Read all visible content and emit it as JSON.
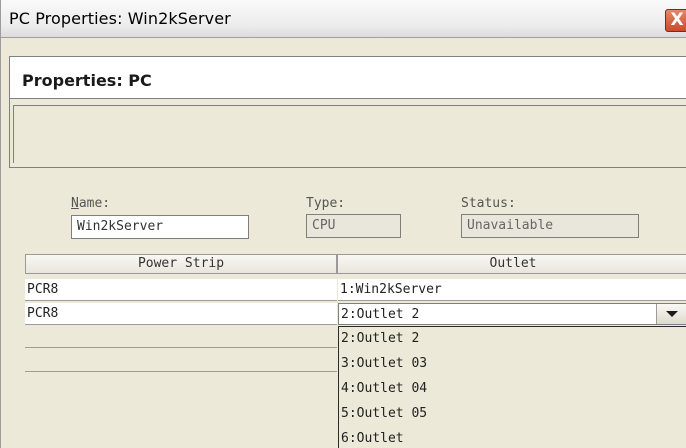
{
  "window": {
    "title": "PC Properties: Win2kServer",
    "close_glyph": "X"
  },
  "header": {
    "title": "Properties: PC"
  },
  "fields": {
    "name_label": "Name:",
    "name_value": "Win2kServer",
    "type_label": "Type:",
    "type_value": "CPU",
    "status_label": "Status:",
    "status_value": "Unavailable"
  },
  "grid": {
    "columns": [
      "Power Strip",
      "Outlet"
    ],
    "rows": [
      {
        "power_strip": "PCR8",
        "outlet": "1:Win2kServer"
      },
      {
        "power_strip": "PCR8",
        "outlet": "2:Outlet 2"
      }
    ]
  },
  "dropdown": {
    "selected": "2:Outlet 2",
    "options": [
      "2:Outlet 2",
      "3:Outlet 03",
      "4:Outlet 04",
      "5:Outlet 05",
      "6:Outlet"
    ]
  },
  "colors": {
    "window_bg": "#ece9d8",
    "close_button": "#cd4a2c"
  },
  "icons": {
    "close": "close-icon",
    "dropdown": "chevron-down-icon"
  }
}
